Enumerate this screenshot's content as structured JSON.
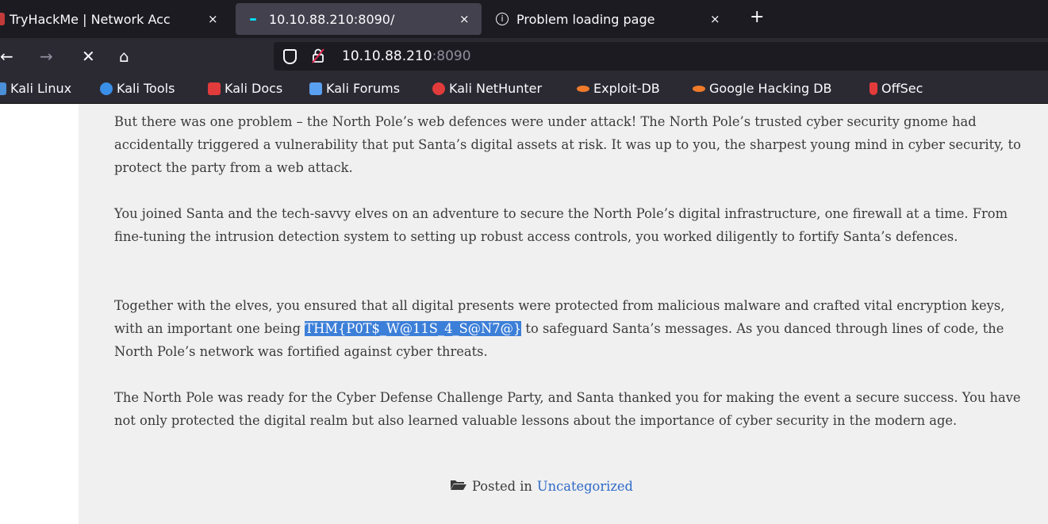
{
  "browser": {
    "tabs": [
      {
        "title": "TryHackMe | Network Acc",
        "close": "×"
      },
      {
        "title": "10.10.88.210:8090/",
        "close": "×"
      },
      {
        "title": "Problem loading page",
        "close": "×"
      }
    ],
    "new_tab": "+",
    "nav": {
      "back": "←",
      "forward": "→",
      "stop": "✕",
      "home": "⌂"
    },
    "url": {
      "host": "10.10.88.210",
      "port": ":8090"
    },
    "bookmarks": [
      {
        "label": "Kali Linux",
        "color": "#4a8fd8"
      },
      {
        "label": "Kali Tools",
        "color": "#3a8fe8"
      },
      {
        "label": "Kali Docs",
        "color": "#e23b3b"
      },
      {
        "label": "Kali Forums",
        "color": "#5aa0f0"
      },
      {
        "label": "Kali NetHunter",
        "color": "#e23b3b"
      },
      {
        "label": "Exploit-DB",
        "color": "#f07a2a"
      },
      {
        "label": "Google Hacking DB",
        "color": "#f07a2a"
      },
      {
        "label": "OffSec",
        "color": "#e23b3b"
      }
    ]
  },
  "article": {
    "p1": "But there was one problem – the North Pole’s web defences were under attack! The North Pole’s trusted cyber security gnome had accidentally triggered a vulnerability that put Santa’s digital assets at risk. It was up to you, the sharpest young mind in cyber security, to protect the party from a web attack.",
    "p2": "You joined Santa and the tech-savvy elves on an adventure to secure the North Pole’s digital infrastructure, one firewall at a time. From fine-tuning the intrusion detection system to setting up robust access controls, you worked diligently to fortify Santa’s defences.",
    "p3_before": "Together with the elves, you ensured that all digital presents were protected from malicious malware and crafted vital encryption keys, with an important one being ",
    "p3_flag": "THM{P0T$_W@11S_4_S@N7@}",
    "p3_after": " to safeguard Santa’s messages. As you danced through lines of code, the North Pole’s network was fortified against cyber threats.",
    "p4": "The North Pole was ready for the Cyber Defense Challenge Party, and Santa thanked you for making the event a secure success. You have not only protected the digital realm but also learned valuable lessons about the importance of cyber security in the modern age.",
    "posted_in": "Posted in",
    "category": "Uncategorized"
  }
}
